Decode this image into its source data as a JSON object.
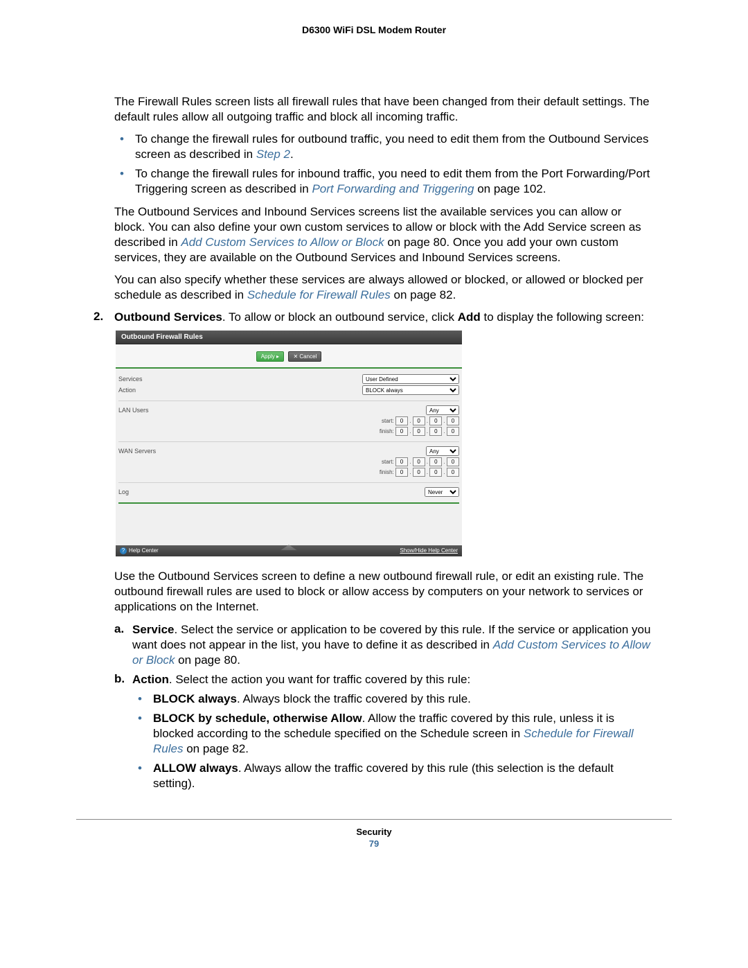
{
  "header": {
    "title": "D6300 WiFi DSL Modem Router"
  },
  "main": {
    "intro": "The Firewall Rules screen lists all firewall rules that have been changed from their default settings. The default rules allow all outgoing traffic and block all incoming traffic.",
    "bullets1": {
      "b1_pre": "To change the firewall rules for outbound traffic, you need to edit them from the Outbound Services screen as described in ",
      "b1_link": "Step 2",
      "b1_post": ".",
      "b2_pre": "To change the firewall rules for inbound traffic, you need to edit them from the Port Forwarding/Port Triggering screen as described in ",
      "b2_link": "Port Forwarding and Triggering",
      "b2_post": " on page 102."
    },
    "para2_pre": "The Outbound Services and Inbound Services screens list the available services you can allow or block. You can also define your own custom services to allow or block with the Add Service screen as described in ",
    "para2_link": "Add Custom Services to Allow or Block",
    "para2_post": " on page 80. Once you add your own custom services, they are available on the Outbound Services and Inbound Services screens.",
    "para3_pre": "You can also specify whether these services are always allowed or blocked, or allowed or blocked per schedule as described in ",
    "para3_link": "Schedule for Firewall Rules",
    "para3_post": " on page 82.",
    "step2": {
      "num": "2.",
      "lead_bold": "Outbound Services",
      "lead": ". To allow or block an outbound service, click ",
      "lead_bold2": "Add",
      "lead2": " to display the following screen:"
    },
    "after_shot": "Use the Outbound Services screen to define a new outbound firewall rule, or edit an existing rule. The outbound firewall rules are used to block or allow access by computers on your network to services or applications on the Internet.",
    "sub_a": {
      "letter": "a.",
      "bold": "Service",
      "text1": ". Select the service or application to be covered by this rule. If the service or application you want does not appear in the list, you have to define it as described in ",
      "link": "Add Custom Services to Allow or Block",
      "text2": " on page 80."
    },
    "sub_b": {
      "letter": "b.",
      "bold": "Action",
      "text": ". Select the action you want for traffic covered by this rule:"
    },
    "bbullets": {
      "b1_bold": "BLOCK always",
      "b1_text": ". Always block the traffic covered by this rule.",
      "b2_bold": "BLOCK by schedule, otherwise Allow",
      "b2_text1": ". Allow the traffic covered by this rule, unless it is blocked according to the schedule specified on the Schedule screen in ",
      "b2_link": "Schedule for Firewall Rules",
      "b2_text2": " on page 82.",
      "b3_bold": "ALLOW always",
      "b3_text": ". Always allow the traffic covered by this rule (this selection is the default setting)."
    }
  },
  "router_ui": {
    "title": "Outbound Firewall Rules",
    "apply": "Apply ▸",
    "cancel": "✕ Cancel",
    "services_label": "Services",
    "services_value": "User Defined",
    "action_label": "Action",
    "action_value": "BLOCK always",
    "lan_label": "LAN Users",
    "wan_label": "WAN Servers",
    "any": "Any",
    "start": "start:",
    "finish": "finish:",
    "oct": "0",
    "log_label": "Log",
    "log_value": "Never",
    "help_center": "Help Center",
    "show_hide": "Show/Hide Help Center"
  },
  "footer": {
    "section": "Security",
    "page": "79"
  }
}
